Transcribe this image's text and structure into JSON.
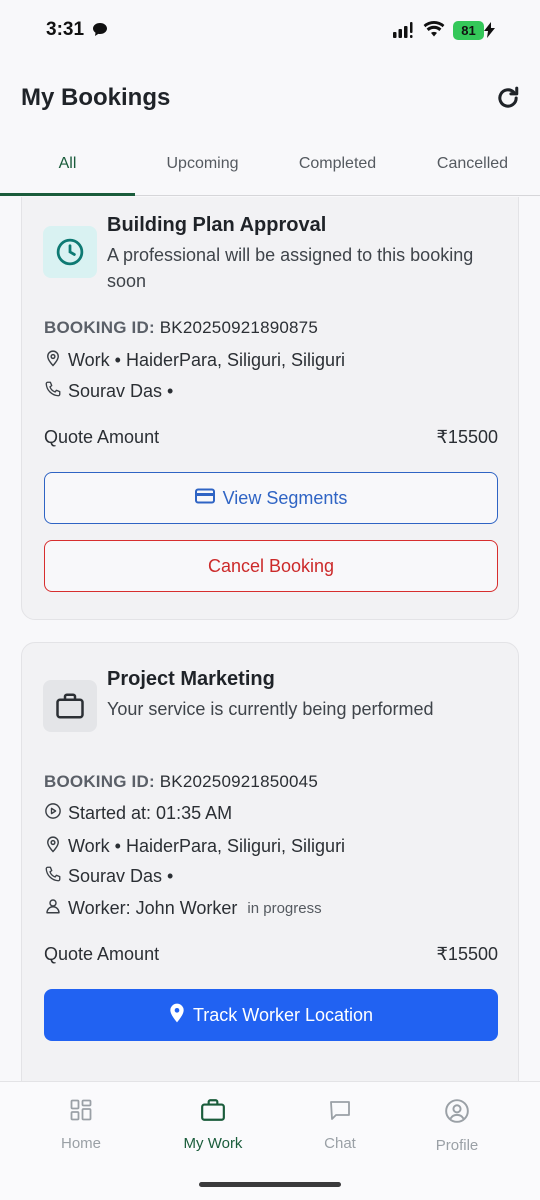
{
  "status_bar": {
    "time": "3:31",
    "battery": "81"
  },
  "header": {
    "title": "My Bookings"
  },
  "tabs": [
    {
      "label": "All"
    },
    {
      "label": "Upcoming"
    },
    {
      "label": "Completed"
    },
    {
      "label": "Cancelled"
    }
  ],
  "bookings": [
    {
      "title": "Building Plan Approval",
      "subtitle": "A professional will be assigned to this booking soon",
      "icon": "clock-icon",
      "booking_id_label": "BOOKING ID:",
      "booking_id": "BK20250921890875",
      "location": "Work • HaiderPara, Siliguri, Siliguri",
      "contact": "Sourav Das •",
      "quote_label": "Quote Amount",
      "quote_amount": "₹15500",
      "view_segments_label": "View Segments",
      "cancel_label": "Cancel Booking"
    },
    {
      "title": "Project Marketing",
      "subtitle": "Your service is currently being performed",
      "icon": "briefcase-icon",
      "booking_id_label": "BOOKING ID:",
      "booking_id": "BK20250921850045",
      "started_at": "Started at: 01:35 AM",
      "location": "Work • HaiderPara, Siliguri, Siliguri",
      "contact": "Sourav Das •",
      "worker": "Worker: John Worker",
      "worker_status": "in progress",
      "quote_label": "Quote Amount",
      "quote_amount": "₹15500",
      "track_label": "Track Worker Location"
    }
  ],
  "bottom_nav": [
    {
      "label": "Home",
      "icon": "grid-icon"
    },
    {
      "label": "My Work",
      "icon": "briefcase-icon"
    },
    {
      "label": "Chat",
      "icon": "chat-icon"
    },
    {
      "label": "Profile",
      "icon": "profile-icon"
    }
  ],
  "colors": {
    "accent_green": "#1a5c3b",
    "primary_blue": "#2162f2",
    "outline_blue": "#2f64c4",
    "danger_red": "#d72e2e",
    "clock_icon_bg": "#d9f2f2",
    "clock_icon": "#0e7a73"
  }
}
